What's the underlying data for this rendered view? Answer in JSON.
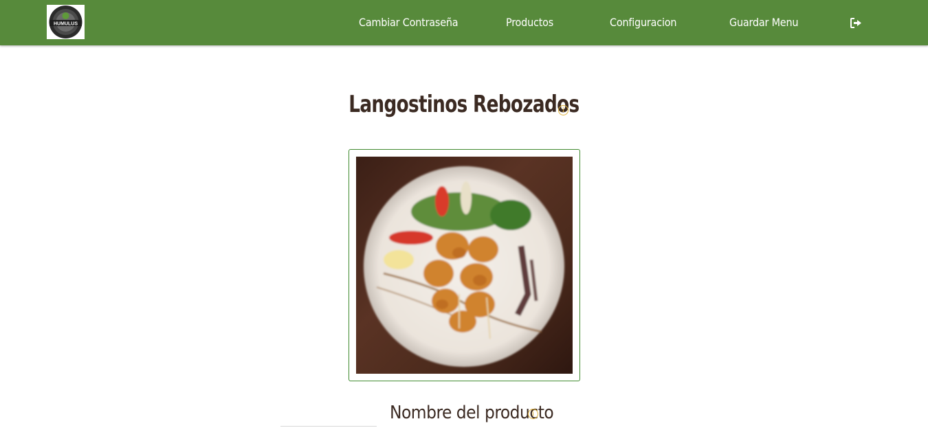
{
  "navbar": {
    "logo_alt": "Humulus logo",
    "logo_text": "HUMULUS",
    "items": [
      {
        "label": "Cambiar Contraseña"
      },
      {
        "label": "Productos"
      },
      {
        "label": "Configuracion"
      },
      {
        "label": "Guardar Menu"
      }
    ],
    "logout_icon": "sign-out-icon",
    "bg_color": "#578a3b"
  },
  "product": {
    "title": "Langostinos Rebozados",
    "title_info_icon": "info-icon",
    "image_alt": "Plato de langostinos rebozados",
    "name_label": "Nombre del producto",
    "name_info_icon": "info-icon"
  },
  "colors": {
    "accent": "#578a3b",
    "frame": "#3f8a2e",
    "heading": "#3b2a22",
    "info": "#e0b23a"
  }
}
